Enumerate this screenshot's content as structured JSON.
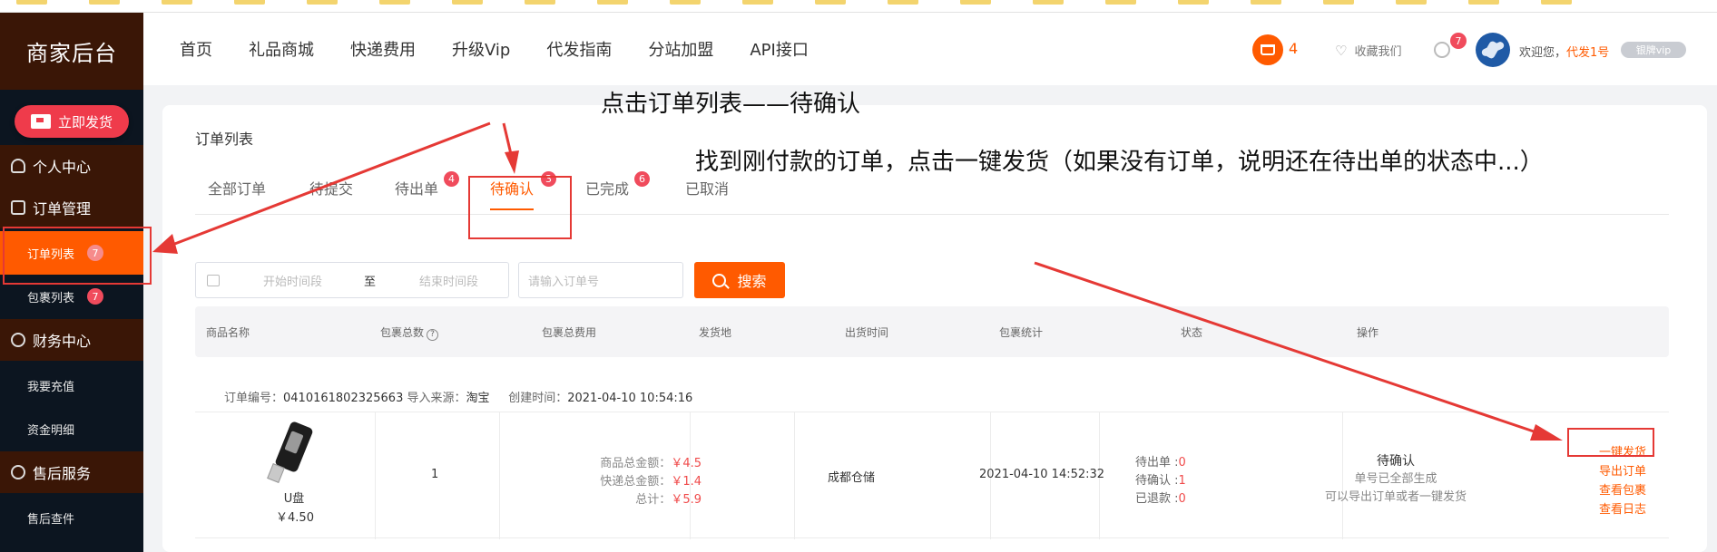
{
  "sidebar": {
    "brand": "商家后台",
    "ship_button": "立即发货",
    "groups": [
      {
        "label": "个人中心"
      },
      {
        "label": "订单管理"
      },
      {
        "label": "财务中心"
      },
      {
        "label": "售后服务"
      }
    ],
    "items": [
      {
        "label": "订单列表",
        "badge": "7"
      },
      {
        "label": "包裹列表",
        "badge": "7"
      },
      {
        "label": "我要充值"
      },
      {
        "label": "资金明细"
      },
      {
        "label": "售后查件"
      }
    ]
  },
  "topnav": {
    "links": [
      "首页",
      "礼品商城",
      "快递费用",
      "升级Vip",
      "代发指南",
      "分站加盟",
      "API接口"
    ],
    "cart_count": "4",
    "favorite": "收藏我们",
    "msg_badge": "7",
    "welcome": "欢迎您，",
    "username": "代发1号",
    "vip": "银牌vip"
  },
  "page": {
    "title": "订单列表",
    "tabs": [
      {
        "label": "全部订单"
      },
      {
        "label": "待提交"
      },
      {
        "label": "待出单",
        "badge": "4"
      },
      {
        "label": "待确认",
        "badge": "3"
      },
      {
        "label": "已完成",
        "badge": "6"
      },
      {
        "label": "已取消"
      }
    ],
    "active_tab": "待确认"
  },
  "filters": {
    "start_placeholder": "开始时间段",
    "to_label": "至",
    "end_placeholder": "结束时间段",
    "order_placeholder": "请输入订单号",
    "search_button": "搜索"
  },
  "table": {
    "headers": [
      "商品名称",
      "包裹总数",
      "包裹总费用",
      "发货地",
      "出货时间",
      "包裹统计",
      "状态",
      "操作"
    ],
    "order": {
      "order_no_label": "订单编号：",
      "order_no": "0410161802325663",
      "source_label": "导入来源：",
      "source": "淘宝",
      "created_label": "创建时间：",
      "created": "2021-04-10 10:54:16",
      "product_name": "U盘",
      "product_price": "￥4.50",
      "package_count": "1",
      "fees": {
        "goods_label": "商品总金额：",
        "goods": "￥4.5",
        "shipping_label": "快递总金额：",
        "shipping": "￥1.4",
        "total_label": "总计：",
        "total": "￥5.9"
      },
      "warehouse": "成都仓储",
      "ship_time": "2021-04-10 14:52:32",
      "stats": {
        "pending_out_label": "待出单 :",
        "pending_out": "0",
        "pending_confirm_label": "待确认 :",
        "pending_confirm": "1",
        "refunded_label": "已退款 :",
        "refunded": "0"
      },
      "status": {
        "main": "待确认",
        "line1": "单号已全部生成",
        "line2": "可以导出订单或者一键发货"
      },
      "actions": [
        "一键发货",
        "导出订单",
        "查看包裹",
        "查看日志"
      ]
    }
  },
  "annotations": {
    "step1": "点击订单列表——待确认",
    "step2": "找到刚付款的订单，点击一键发货（如果没有订单，说明还在待出单的状态中...）"
  },
  "colors": {
    "accent": "#ff5a00",
    "badge": "#f04b5c",
    "annotation": "#e53935",
    "sidebar_dark": "#0c1520",
    "sidebar_group": "#3a1606"
  }
}
